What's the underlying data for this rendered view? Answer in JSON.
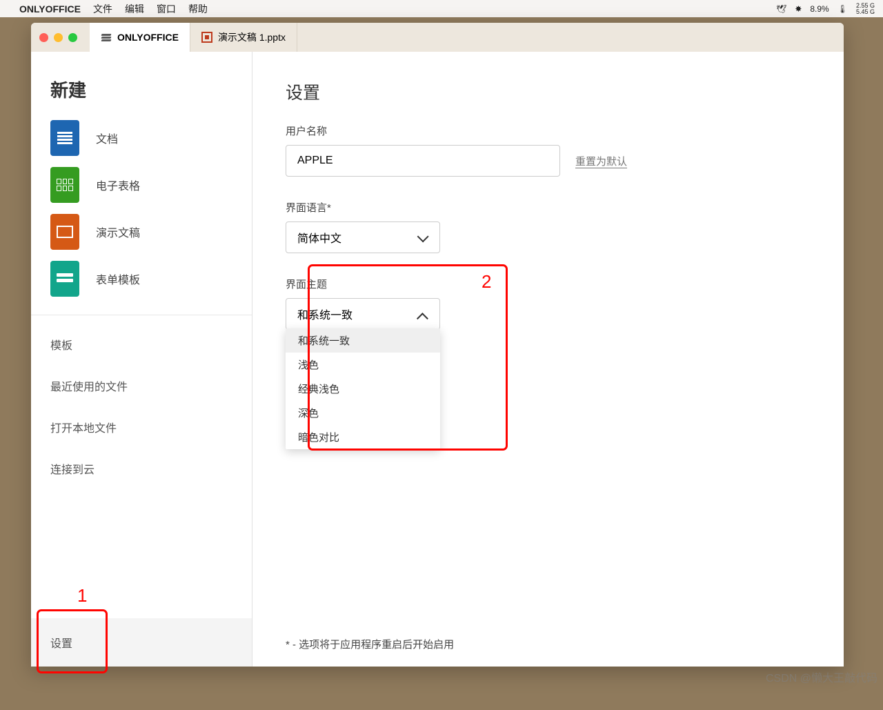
{
  "menubar": {
    "app": "ONLYOFFICE",
    "items": [
      "文件",
      "编辑",
      "窗口",
      "帮助"
    ],
    "cpu_pct": "8.9%",
    "mem": {
      "used": "2.55 G",
      "total": "5.45 G"
    }
  },
  "tabs": {
    "home": "ONLYOFFICE",
    "doc": "演示文稿 1.pptx"
  },
  "sidebar": {
    "new_heading": "新建",
    "create": {
      "doc": "文档",
      "sheet": "电子表格",
      "pres": "演示文稿",
      "form": "表单模板"
    },
    "links": {
      "templates": "模板",
      "recent": "最近使用的文件",
      "open_local": "打开本地文件",
      "cloud": "连接到云"
    },
    "settings": "设置"
  },
  "settings": {
    "title": "设置",
    "username_label": "用户名称",
    "username_value": "APPLE",
    "reset_default": "重置为默认",
    "lang_label": "界面语言*",
    "lang_value": "简体中文",
    "theme_label": "界面主题",
    "theme_value": "和系统一致",
    "theme_options": [
      "和系统一致",
      "浅色",
      "经典浅色",
      "深色",
      "暗色对比"
    ],
    "footnote": "* - 选项将于应用程序重启后开始启用"
  },
  "annotations": {
    "one": "1",
    "two": "2"
  },
  "watermark": "CSDN @懒大王敲代码"
}
